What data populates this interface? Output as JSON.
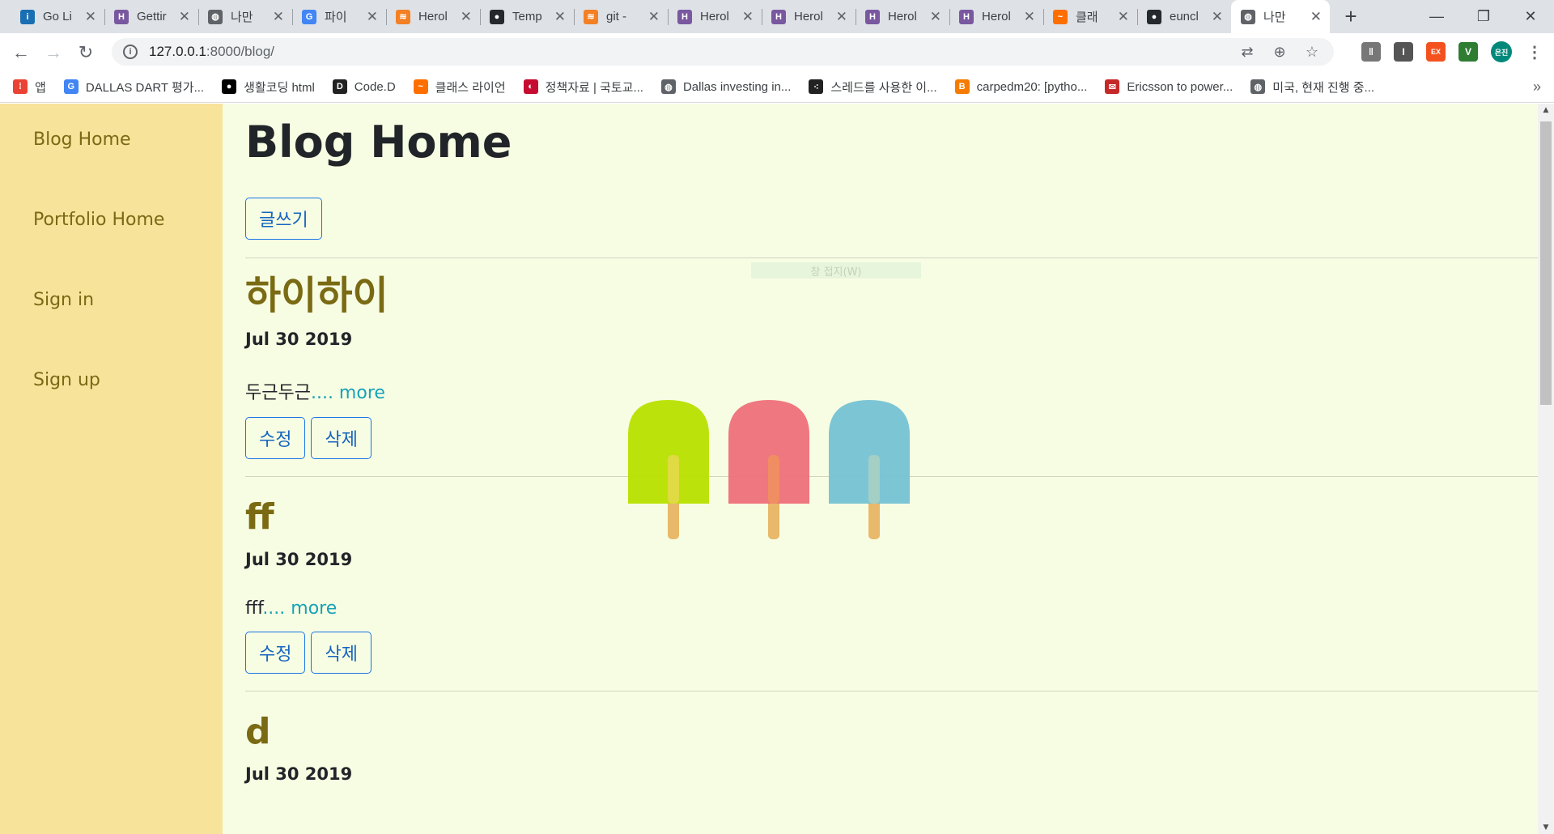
{
  "browser": {
    "tabs": [
      {
        "title": "Go Li",
        "favicon_color": "#1a6fb3",
        "favicon_glyph": "i"
      },
      {
        "title": "Gettir",
        "favicon_color": "#79589f",
        "favicon_glyph": "H"
      },
      {
        "title": "나만",
        "favicon_color": "#5f6368",
        "favicon_glyph": "◍"
      },
      {
        "title": "파이",
        "favicon_color": "#4285f4",
        "favicon_glyph": "G"
      },
      {
        "title": "Herol",
        "favicon_color": "#f48024",
        "favicon_glyph": "≋"
      },
      {
        "title": "Temp",
        "favicon_color": "#24292e",
        "favicon_glyph": "●"
      },
      {
        "title": "git -",
        "favicon_color": "#f48024",
        "favicon_glyph": "≋"
      },
      {
        "title": "Herol",
        "favicon_color": "#79589f",
        "favicon_glyph": "H"
      },
      {
        "title": "Herol",
        "favicon_color": "#79589f",
        "favicon_glyph": "H"
      },
      {
        "title": "Herol",
        "favicon_color": "#79589f",
        "favicon_glyph": "H"
      },
      {
        "title": "Herol",
        "favicon_color": "#79589f",
        "favicon_glyph": "H"
      },
      {
        "title": "클래",
        "favicon_color": "#ff6f00",
        "favicon_glyph": "~"
      },
      {
        "title": "euncl",
        "favicon_color": "#24292e",
        "favicon_glyph": "●"
      },
      {
        "title": "나만",
        "favicon_color": "#5f6368",
        "favicon_glyph": "◍",
        "active": true
      }
    ],
    "url_host": "127.0.0.1",
    "url_rest": ":8000/blog/",
    "bookmarks": [
      {
        "label": "앱",
        "icon_color": "#ea4335",
        "glyph": "⁞"
      },
      {
        "label": "DALLAS DART 평가...",
        "icon_color": "#4285f4",
        "glyph": "G"
      },
      {
        "label": "생활코딩 html",
        "icon_color": "#000000",
        "glyph": "●"
      },
      {
        "label": "Code.D",
        "icon_color": "#222222",
        "glyph": "D"
      },
      {
        "label": "클래스 라이언",
        "icon_color": "#ff6f00",
        "glyph": "~"
      },
      {
        "label": "정책자료 | 국토교...",
        "icon_color": "#c60c30",
        "glyph": "◐"
      },
      {
        "label": "Dallas investing in...",
        "icon_color": "#5f6368",
        "glyph": "◍"
      },
      {
        "label": "스레드를 사용한 이...",
        "icon_color": "#222222",
        "glyph": "⁖"
      },
      {
        "label": "carpedm20: [pytho...",
        "icon_color": "#f57c00",
        "glyph": "B"
      },
      {
        "label": "Ericsson to power...",
        "icon_color": "#c62828",
        "glyph": "✉"
      },
      {
        "label": "미국, 현재 진행 중...",
        "icon_color": "#5f6368",
        "glyph": "◍"
      }
    ],
    "profile_initials": "은진"
  },
  "page": {
    "sidebar": [
      "Blog Home",
      "Portfolio Home",
      "Sign in",
      "Sign up"
    ],
    "title": "Blog Home",
    "write_label": "글쓰기",
    "tooltip_ghost": "창 접지(W)",
    "posts": [
      {
        "title": "하이하이",
        "date": "Jul 30 2019",
        "excerpt": "두근두근",
        "more": ".... more",
        "edit": "수정",
        "delete": "삭제"
      },
      {
        "title": "ff",
        "date": "Jul 30 2019",
        "excerpt": "fff",
        "more": ".... more",
        "edit": "수정",
        "delete": "삭제"
      },
      {
        "title": "d",
        "date": "Jul 30 2019"
      }
    ]
  },
  "colors": {
    "page_bg": "#f7fde3",
    "sidebar_bg": "#f8e39b",
    "link_olive": "#7a6a14",
    "button_blue": "#1a73e8",
    "more_teal": "#17a2b8"
  }
}
